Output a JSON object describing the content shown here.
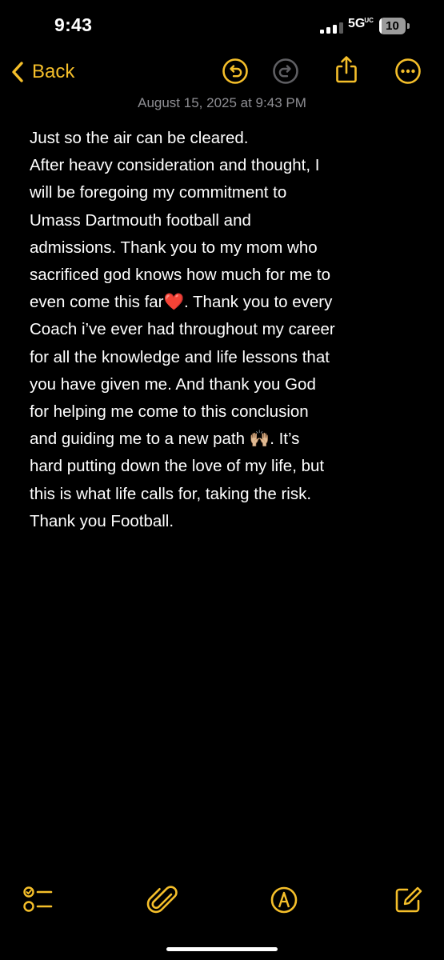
{
  "status_bar": {
    "time": "9:43",
    "network_main": "5G",
    "network_sup": "UC",
    "battery_level": "10",
    "battery_fraction": 0.1,
    "signal_bars_active": 3,
    "signal_bars_total": 4
  },
  "toolbar": {
    "back_label": "Back",
    "accent_color": "#f5bf2a",
    "icons": {
      "back": "chevron-left-icon",
      "undo": "undo-icon",
      "redo": "redo-icon",
      "share": "share-icon",
      "more": "more-icon"
    }
  },
  "note": {
    "date": "August 15, 2025 at 9:43 PM",
    "lines": [
      "Just so the air can be cleared.",
      "After heavy consideration and thought, I",
      "will be foregoing my commitment to",
      "Umass Dartmouth football and",
      "admissions. Thank you to my mom who",
      "sacrificed god knows how much for me to",
      "even come this far❤️. Thank you to every",
      "Coach i’ve ever had throughout my career",
      "for all the knowledge and life lessons that",
      "you have given me. And thank you God",
      "for helping me come to this conclusion",
      "and guiding me to a new path 🙌🏼. It’s",
      "hard putting down the love of my life, but",
      "this is what life calls for, taking the risk.",
      "Thank you Football."
    ]
  },
  "bottom_bar": {
    "icons": {
      "checklist": "checklist-icon",
      "attachment": "paperclip-icon",
      "markup": "markup-pen-icon",
      "compose": "compose-icon"
    }
  },
  "colors": {
    "background": "#000000",
    "text": "#ffffff",
    "date_text": "#8e8e93",
    "accent": "#f5bf2a"
  }
}
